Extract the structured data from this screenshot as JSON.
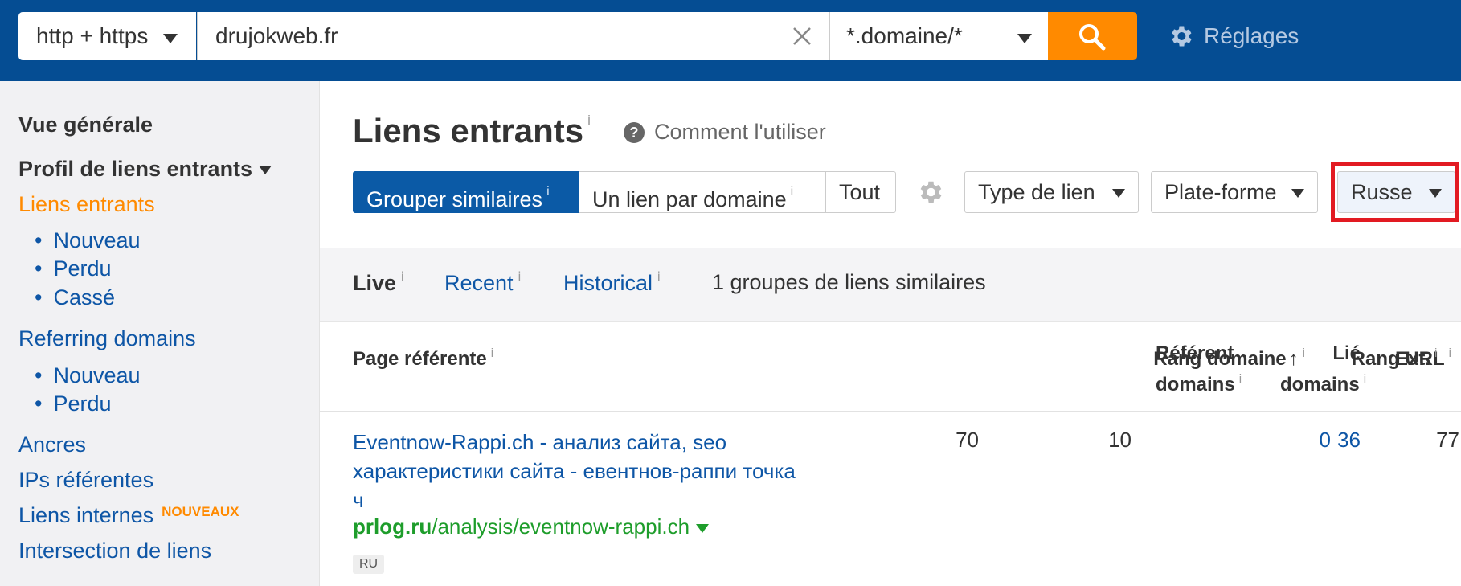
{
  "topbar": {
    "protocol": "http + https",
    "url_value": "drujokweb.fr",
    "mode": "*.domaine/*",
    "settings_label": "Réglages"
  },
  "sidebar": {
    "overview": "Vue générale",
    "profile": "Profil de liens entrants",
    "backlinks": "Liens entrants",
    "backlinks_sub": [
      "Nouveau",
      "Perdu",
      "Cassé"
    ],
    "referring_domains": "Referring domains",
    "referring_sub": [
      "Nouveau",
      "Perdu"
    ],
    "anchors": "Ancres",
    "referring_ips": "IPs référentes",
    "internal_links": "Liens internes",
    "internal_badge": "NOUVEAUX",
    "link_intersect": "Intersection de liens"
  },
  "main": {
    "title": "Liens entrants",
    "info": "i",
    "howto": "Comment l'utiliser",
    "howto_icon": "?",
    "groups": {
      "similar": "Grouper similaires",
      "one_per_domain": "Un lien par domaine",
      "all": "Tout"
    },
    "filters": {
      "link_type": "Type de lien",
      "platform": "Plate-forme",
      "language": "Russe"
    },
    "tabs": {
      "live": "Live",
      "recent": "Recent",
      "historical": "Historical",
      "count_text": "1 groupes de liens similaires"
    },
    "columns": {
      "page": "Page référente",
      "dr": "Rang domaine",
      "dr_arrow": "↑",
      "ur": "Rang URL",
      "ref_domains_1": "Référent",
      "ref_domains_2": "domains",
      "linked_1": "Lié",
      "linked_2": "domains",
      "ext": "Ext."
    },
    "row": {
      "title": "Eventnow-Rappi.ch - анализ сайта, seo характеристики сайта - евентнов-раппи точка ч",
      "domain": "prlog.ru",
      "path": "/analysis/eventnow-rappi.ch",
      "lang": "RU",
      "dr": "70",
      "ur": "10",
      "ref_domains": "0",
      "linked_domains": "36",
      "ext": "77"
    }
  }
}
